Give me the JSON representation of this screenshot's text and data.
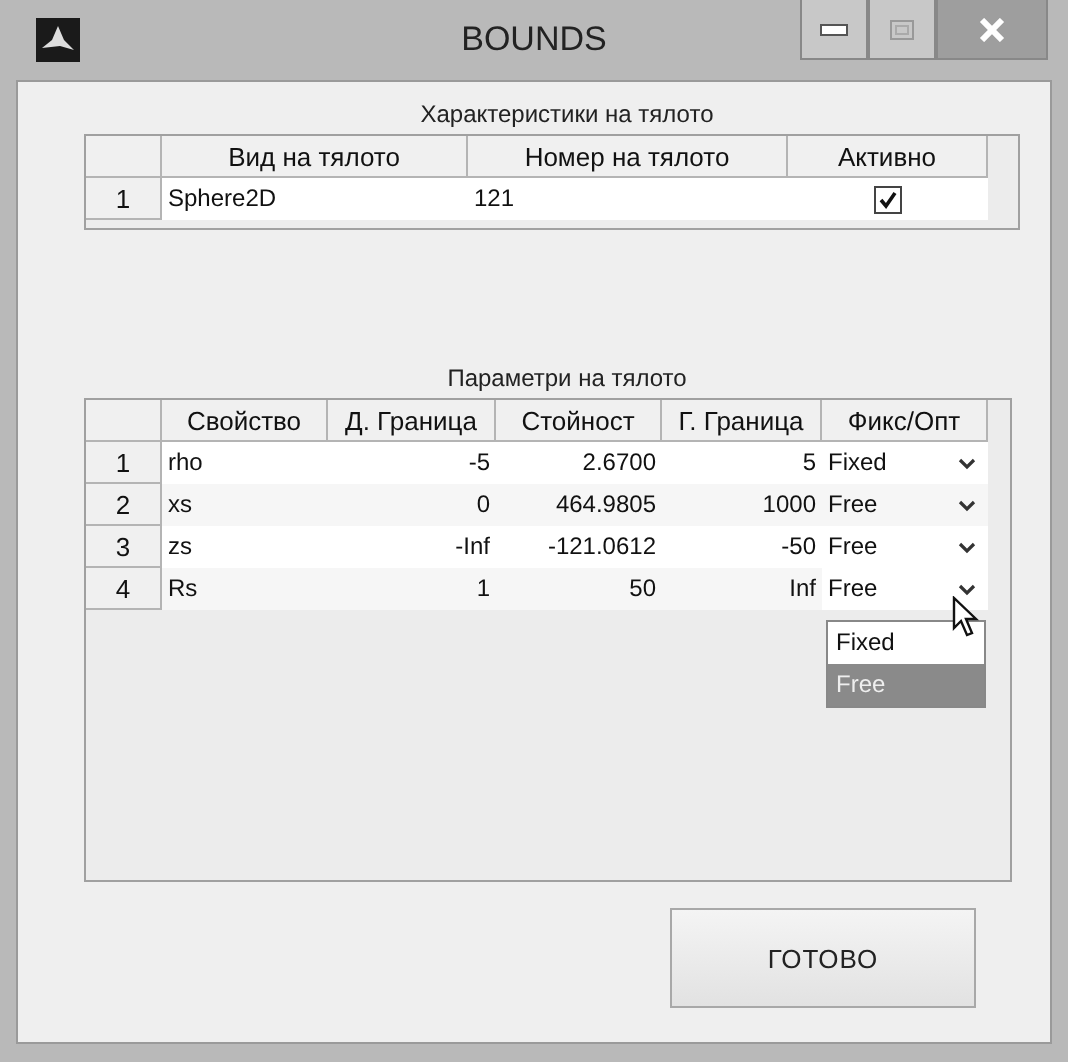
{
  "window": {
    "title": "BOUNDS"
  },
  "body_table": {
    "title": "Характеристики на тялото",
    "columns": [
      "Вид на тялото",
      "Номер на тялото",
      "Активно"
    ],
    "rows": [
      {
        "index": "1",
        "type": "Sphere2D",
        "number": "121",
        "active": true
      }
    ]
  },
  "params_table": {
    "title": "Параметри на тялото",
    "columns": [
      "Свойство",
      "Д. Граница",
      "Стойност",
      "Г. Граница",
      "Фикс/Опт"
    ],
    "rows": [
      {
        "index": "1",
        "property": "rho",
        "lower": "-5",
        "value": "2.6700",
        "upper": "5",
        "mode": "Fixed",
        "open": false
      },
      {
        "index": "2",
        "property": "xs",
        "lower": "0",
        "value": "464.9805",
        "upper": "1000",
        "mode": "Free",
        "open": false
      },
      {
        "index": "3",
        "property": "zs",
        "lower": "-Inf",
        "value": "-121.0612",
        "upper": "-50",
        "mode": "Free",
        "open": false
      },
      {
        "index": "4",
        "property": "Rs",
        "lower": "1",
        "value": "50",
        "upper": "Inf",
        "mode": "Free",
        "open": true
      }
    ],
    "dropdown_options": [
      {
        "label": "Fixed",
        "selected": false
      },
      {
        "label": "Free",
        "selected": true
      }
    ]
  },
  "button": "ГОТОВО"
}
